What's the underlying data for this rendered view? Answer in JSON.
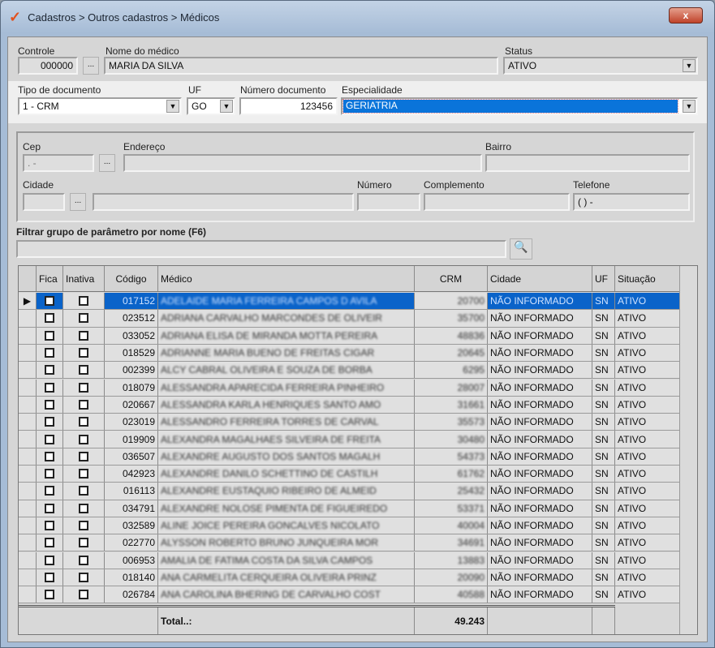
{
  "window": {
    "title": "Cadastros > Outros cadastros > Médicos",
    "close": "x"
  },
  "form": {
    "controle_label": "Controle",
    "controle": "000000",
    "ellipsis": "...",
    "nome_label": "Nome do médico",
    "nome": "MARIA DA SILVA",
    "status_label": "Status",
    "status": "ATIVO",
    "tipo_label": "Tipo de documento",
    "tipo": "1 - CRM",
    "uf_label": "UF",
    "uf": "GO",
    "numero_label": "Número documento",
    "numero": "123456",
    "esp_label": "Especialidade",
    "esp": "GERIATRIA"
  },
  "address": {
    "cep_label": "Cep",
    "cep": " .  -",
    "end_label": "Endereço",
    "bairro_label": "Bairro",
    "cidade_label": "Cidade",
    "numero_label": "Número",
    "compl_label": "Complemento",
    "tel_label": "Telefone",
    "tel": "( )    -"
  },
  "filter": {
    "label": "Filtrar grupo de parâmetro por nome (F6)",
    "value": ""
  },
  "table": {
    "headers": [
      "Fica",
      "Inativa",
      "Código",
      "Médico",
      "CRM",
      "Cidade",
      "UF",
      "Situação"
    ],
    "rows": [
      [
        "017152",
        "ADELAIDE MARIA FERREIRA CAMPOS D AVILA",
        "20700"
      ],
      [
        "023512",
        "ADRIANA CARVALHO MARCONDES DE OLIVEIR",
        "35700"
      ],
      [
        "033052",
        "ADRIANA ELISA DE MIRANDA MOTTA PEREIRA",
        "48836"
      ],
      [
        "018529",
        "ADRIANNE MARIA BUENO DE FREITAS CIGAR",
        "20645"
      ],
      [
        "002399",
        "ALCY CABRAL OLIVEIRA E SOUZA DE BORBA",
        "6295"
      ],
      [
        "018079",
        "ALESSANDRA APARECIDA FERREIRA PINHEIRO",
        "28007"
      ],
      [
        "020667",
        "ALESSANDRA KARLA HENRIQUES SANTO AMO",
        "31661"
      ],
      [
        "023019",
        "ALESSANDRO FERREIRA TORRES DE CARVAL",
        "35573"
      ],
      [
        "019909",
        "ALEXANDRA MAGALHAES SILVEIRA DE FREITA",
        "30480"
      ],
      [
        "036507",
        "ALEXANDRE AUGUSTO DOS SANTOS MAGALH",
        "54373"
      ],
      [
        "042923",
        "ALEXANDRE DANILO SCHETTINO DE CASTILH",
        "61762"
      ],
      [
        "016113",
        "ALEXANDRE EUSTAQUIO RIBEIRO DE ALMEID",
        "25432"
      ],
      [
        "034791",
        "ALEXANDRE NOLOSE PIMENTA DE FIGUEIREDO",
        "53371"
      ],
      [
        "032589",
        "ALINE JOICE PEREIRA GONCALVES NICOLATO",
        "40004"
      ],
      [
        "022770",
        "ALYSSON ROBERTO BRUNO JUNQUEIRA MOR",
        "34691"
      ],
      [
        "006953",
        "AMALIA DE FATIMA COSTA DA SILVA CAMPOS",
        "13883"
      ],
      [
        "018140",
        "ANA CARMELITA CERQUEIRA OLIVEIRA PRINZ",
        "20090"
      ],
      [
        "026784",
        "ANA CAROLINA BHERING DE CARVALHO COST",
        "40588"
      ]
    ],
    "cidade": "NÃO INFORMADO",
    "uf": "SN",
    "situacao": "ATIVO",
    "total_label": "Total..:",
    "total": "49.243"
  }
}
